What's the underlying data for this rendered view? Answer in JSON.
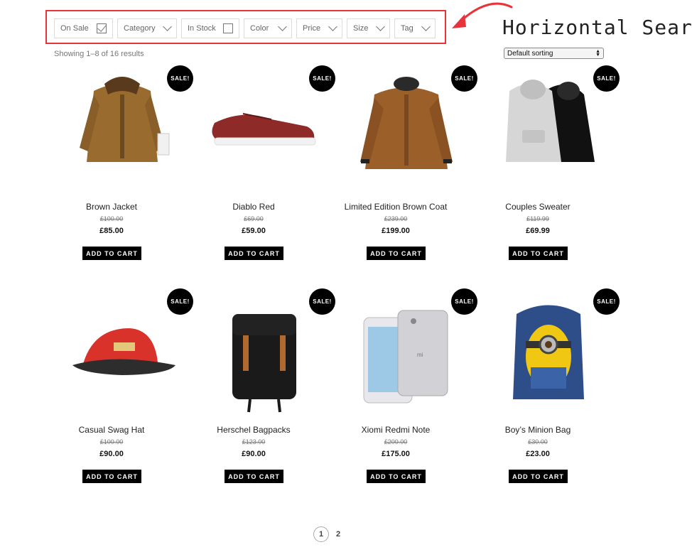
{
  "filters": {
    "on_sale": "On Sale",
    "category": "Category",
    "in_stock": "In Stock",
    "color": "Color",
    "price": "Price",
    "size": "Size",
    "tag": "Tag"
  },
  "annotation": "Horizontal Search",
  "results_text": "Showing 1–8 of 16 results",
  "sort": {
    "selected": "Default sorting"
  },
  "products": [
    {
      "badge": "SALE!",
      "name": "Brown Jacket",
      "old": "£100.00",
      "price": "£85.00",
      "button": "ADD TO CART",
      "icon": "jacket-image"
    },
    {
      "badge": "SALE!",
      "name": "Diablo Red",
      "old": "£69.00",
      "price": "£59.00",
      "button": "ADD TO CART",
      "icon": "shoe-image"
    },
    {
      "badge": "SALE!",
      "name": "Limited Edition Brown Coat",
      "old": "£239.00",
      "price": "£199.00",
      "button": "ADD TO CART",
      "icon": "coat-image"
    },
    {
      "badge": "SALE!",
      "name": "Couples Sweater",
      "old": "£119.99",
      "price": "£69.99",
      "button": "ADD TO CART",
      "icon": "hoodies-image"
    },
    {
      "badge": "SALE!",
      "name": "Casual Swag Hat",
      "old": "£100.00",
      "price": "£90.00",
      "button": "ADD TO CART",
      "icon": "cap-image"
    },
    {
      "badge": "SALE!",
      "name": "Herschel Bagpacks",
      "old": "£123.00",
      "price": "£90.00",
      "button": "ADD TO CART",
      "icon": "backpack-image"
    },
    {
      "badge": "SALE!",
      "name": "Xiomi Redmi Note",
      "old": "£200.00",
      "price": "£175.00",
      "button": "ADD TO CART",
      "icon": "phone-image"
    },
    {
      "badge": "SALE!",
      "name": "Boy’s Minion Bag",
      "old": "£30.00",
      "price": "£23.00",
      "button": "ADD TO CART",
      "icon": "minion-bag-image"
    }
  ],
  "pagination": {
    "current": "1",
    "next": "2"
  },
  "colors": {
    "accent": "#e8333a",
    "badge": "#000000"
  }
}
